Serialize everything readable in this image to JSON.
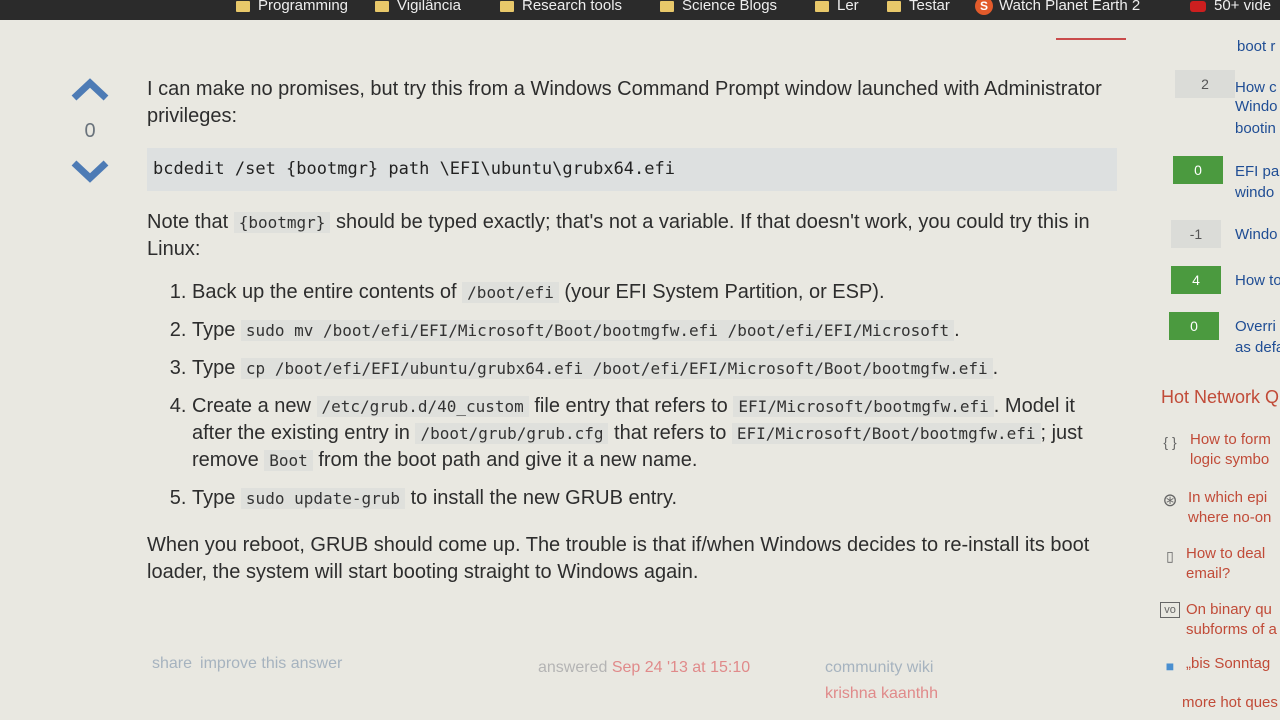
{
  "bookmarks": [
    {
      "label": "Programming",
      "icon": "folder-icon"
    },
    {
      "label": "Vigilância",
      "icon": "folder-icon"
    },
    {
      "label": "Research tools",
      "icon": "folder-icon"
    },
    {
      "label": "Science Blogs",
      "icon": "folder-icon"
    },
    {
      "label": "Ler",
      "icon": "folder-icon"
    },
    {
      "label": "Testar",
      "icon": "folder-icon"
    },
    {
      "label": "Watch Planet Earth 2",
      "icon": "s-logo-icon"
    },
    {
      "label": "50+ vide",
      "icon": "youtube-icon"
    }
  ],
  "vote": {
    "count": "0"
  },
  "answer": {
    "intro": "I can make no promises, but try this from a Windows Command Prompt window launched with Administrator privileges:",
    "command": "bcdedit /set {bootmgr} path \\EFI\\ubuntu\\grubx64.efi",
    "note_pre": "Note that ",
    "note_code": "{bootmgr}",
    "note_post": " should be typed exactly; that's not a variable. If that doesn't work, you could try this in Linux:",
    "steps": [
      {
        "pre": "Back up the entire contents of ",
        "code": "/boot/efi",
        "post": " (your EFI System Partition, or ESP)."
      },
      {
        "pre": "Type ",
        "code": "sudo mv /boot/efi/EFI/Microsoft/Boot/bootmgfw.efi /boot/efi/EFI/Microsoft",
        "post": "."
      },
      {
        "pre": "Type ",
        "code": "cp /boot/efi/EFI/ubuntu/grubx64.efi /boot/efi/EFI/Microsoft/Boot/bootmgfw.efi",
        "post": "."
      },
      {
        "pre": "Create a new ",
        "code": "/etc/grub.d/40_custom",
        "mid": " file entry that refers to ",
        "code2": "EFI/Microsoft/bootmgfw.efi",
        "mid2": ". Model it after the existing entry in ",
        "code3": "/boot/grub/grub.cfg",
        "mid3": " that refers to ",
        "code4": "EFI/Microsoft/Boot/bootmgfw.efi",
        "mid4": "; just remove ",
        "code5": "Boot",
        "post": " from the boot path and give it a new name."
      },
      {
        "pre": "Type ",
        "code": "sudo update-grub",
        "post": " to install the new GRUB entry."
      }
    ],
    "closing": "When you reboot, GRUB should come up. The trouble is that if/when Windows decides to re-install its boot loader, the system will start booting straight to Windows again."
  },
  "footer": {
    "share": "share",
    "improve": "improve this answer",
    "answered_label": "answered",
    "answered_date": "Sep 24 '13 at 15:10",
    "community": "community wiki",
    "author": "krishna kaanthh"
  },
  "sidebar": {
    "related": [
      {
        "score": "",
        "text": "boot r",
        "style": "none"
      },
      {
        "score": "2",
        "text": "How c",
        "line2": "Windo",
        "line3": "bootin",
        "style": "gray"
      },
      {
        "score": "0",
        "text": "EFI pa",
        "line2": "windo",
        "style": "green"
      },
      {
        "score": "-1",
        "text": "Windo",
        "style": "gray"
      },
      {
        "score": "4",
        "text": "How to",
        "style": "green"
      },
      {
        "score": "0",
        "text": "Overri",
        "line2": "as defa",
        "style": "green"
      }
    ],
    "hot_title": "Hot Network Q",
    "hot": [
      {
        "icon": "{ }",
        "text": "How to form",
        "line2": "logic symbo"
      },
      {
        "icon": "⊛",
        "text": "In which epi",
        "line2": "where no-on"
      },
      {
        "icon": "▯",
        "text": "How to deal",
        "line2": "email?"
      },
      {
        "icon": "vo",
        "text": "On binary qu",
        "line2": "subforms of a"
      },
      {
        "icon": "■",
        "text": "„bis Sonntag",
        "line2": ""
      }
    ],
    "more_hot": "more hot ques"
  }
}
